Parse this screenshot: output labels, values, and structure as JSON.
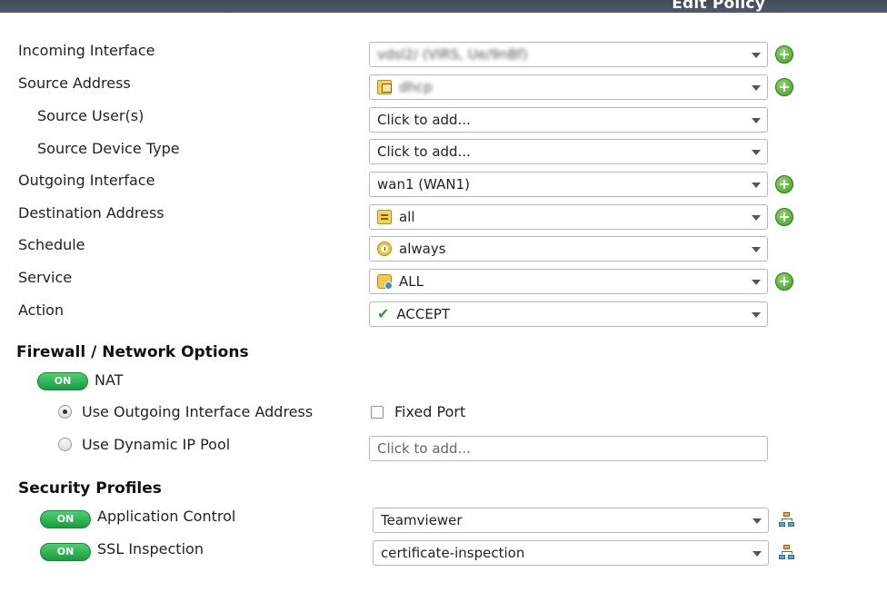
{
  "window": {
    "title": "Edit Policy"
  },
  "fields": {
    "incoming_interface": {
      "label": "Incoming Interface",
      "value": "vdsl2/ (VIRS, Ue/9nBf)"
    },
    "source_address": {
      "label": "Source Address",
      "value": "dhcp"
    },
    "source_users": {
      "label": "Source User(s)",
      "value": "Click to add..."
    },
    "source_device_type": {
      "label": "Source Device Type",
      "value": "Click to add..."
    },
    "outgoing_interface": {
      "label": "Outgoing Interface",
      "value": "wan1 (WAN1)"
    },
    "destination_address": {
      "label": "Destination Address",
      "value": "all"
    },
    "schedule": {
      "label": "Schedule",
      "value": "always"
    },
    "service": {
      "label": "Service",
      "value": "ALL"
    },
    "action": {
      "label": "Action",
      "value": "ACCEPT"
    }
  },
  "firewall": {
    "title": "Firewall / Network Options",
    "nat_toggle": "ON",
    "nat_label": "NAT",
    "use_outgoing_label": "Use Outgoing Interface Address",
    "fixed_port_label": "Fixed Port",
    "use_dynamic_label": "Use Dynamic IP Pool",
    "dynamic_placeholder": "Click to add..."
  },
  "security": {
    "title": "Security Profiles",
    "app_control": {
      "toggle": "ON",
      "label": "Application Control",
      "value": "Teamviewer"
    },
    "ssl_inspection": {
      "toggle": "ON",
      "label": "SSL Inspection",
      "value": "certificate-inspection"
    }
  },
  "icons": {
    "add": "plus-circle-icon",
    "address": "address-object-icon",
    "schedule": "clock-icon",
    "service": "service-icon",
    "accept": "checkmark-icon",
    "profile": "profile-hierarchy-icon"
  },
  "colors": {
    "toggle_on": "#1faa47",
    "add_button": "#4caf2a",
    "titlebar": "#47525e"
  }
}
